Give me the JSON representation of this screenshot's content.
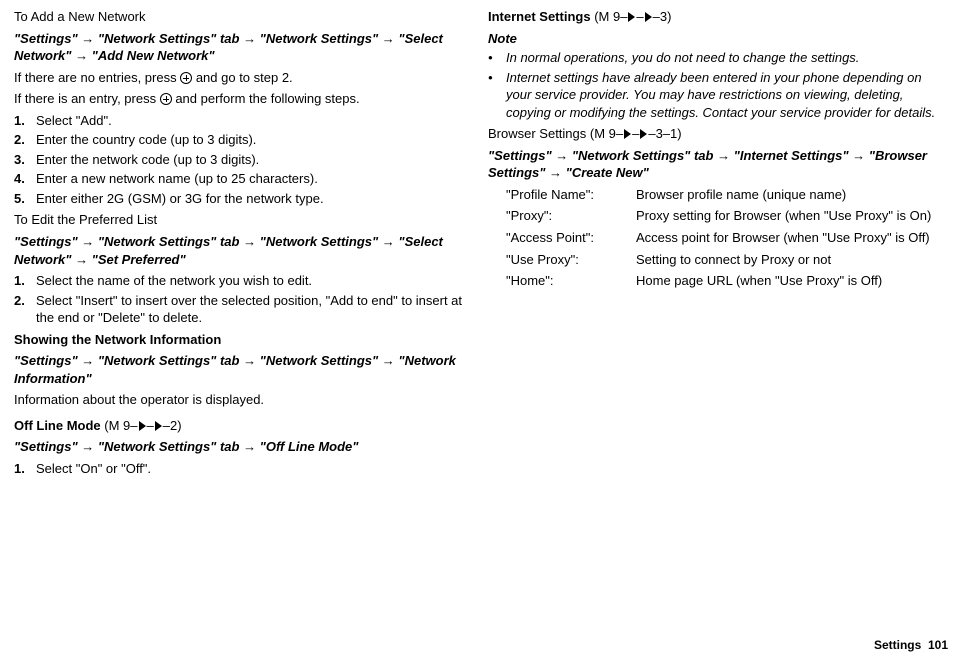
{
  "left": {
    "add_heading": "To Add a New Network",
    "add_path": "\"Settings\" → \"Network Settings\" tab → \"Network Settings\" → \"Select Network\" → \"Add New Network\"",
    "add_p1a": "If there are no entries, press ",
    "add_p1b": " and go to step 2.",
    "add_p2a": "If there is an entry, press ",
    "add_p2b": " and perform the following steps.",
    "steps_add": [
      "Select \"Add\".",
      "Enter the country code (up to 3 digits).",
      "Enter the network code (up to 3 digits).",
      "Enter a new network name (up to 25 characters).",
      "Enter either 2G (GSM) or 3G for the network type."
    ],
    "edit_heading": "To Edit the Preferred List",
    "edit_path": "\"Settings\" → \"Network Settings\" tab → \"Network Settings\" → \"Select Network\" → \"Set Preferred\"",
    "steps_edit": [
      "Select the name of the network you wish to edit.",
      "Select \"Insert\" to insert over the selected position, \"Add to end\" to insert at the end or \"Delete\" to delete."
    ],
    "show_heading": "Showing the Network Information",
    "show_path": "\"Settings\" → \"Network Settings\" tab → \"Network Settings\" → \"Network Information\"",
    "show_desc": "Information about the operator is displayed.",
    "offline_heading_pre": "Off Line Mode ",
    "offline_heading_m": "(M 9–",
    "offline_heading_suffix": "–2)",
    "offline_path": "\"Settings\" → \"Network Settings\" tab → \"Off Line Mode\"",
    "steps_offline": [
      "Select \"On\" or \"Off\"."
    ]
  },
  "right": {
    "inet_heading_pre": "Internet Settings ",
    "inet_heading_m": "(M 9–",
    "inet_heading_suffix": "–3)",
    "note_label": "Note",
    "notes": [
      "In normal operations, you do not need to change the settings.",
      "Internet settings have already been entered in your phone depending on your service provider. You may have restrictions on viewing, deleting, copying or modifying the settings. Contact your service provider for details."
    ],
    "browser_heading_pre": "Browser Settings ",
    "browser_heading_m": "(M 9–",
    "browser_heading_suffix": "–3–1)",
    "browser_path": "\"Settings\" → \"Network Settings\" tab → \"Internet Settings\" → \"Browser Settings\" → \"Create New\"",
    "table": [
      {
        "k": "\"Profile Name\":",
        "v": "Browser profile name (unique name)"
      },
      {
        "k": "\"Proxy\":",
        "v": "Proxy setting for Browser (when \"Use Proxy\" is On)"
      },
      {
        "k": "\"Access Point\":",
        "v": "Access point for Browser (when \"Use Proxy\" is Off)"
      },
      {
        "k": "\"Use Proxy\":",
        "v": "Setting to connect by Proxy or not"
      },
      {
        "k": "\"Home\":",
        "v": "Home page URL (when \"Use Proxy\" is Off)"
      }
    ]
  },
  "footer": {
    "section": "Settings",
    "page": "101"
  }
}
